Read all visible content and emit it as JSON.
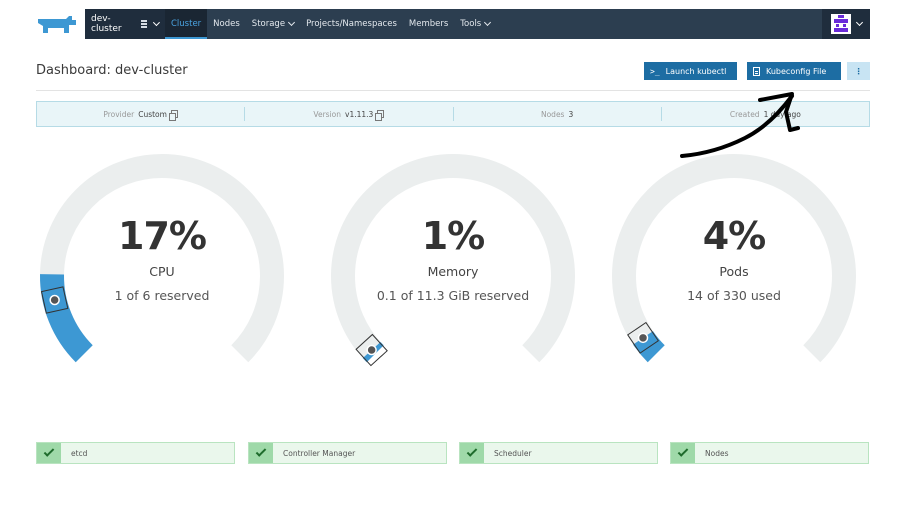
{
  "nav": {
    "cluster_name": "dev-cluster",
    "items": [
      {
        "label": "Cluster",
        "active": true
      },
      {
        "label": "Nodes"
      },
      {
        "label": "Storage",
        "dropdown": true
      },
      {
        "label": "Projects/Namespaces"
      },
      {
        "label": "Members"
      },
      {
        "label": "Tools",
        "dropdown": true
      }
    ]
  },
  "header": {
    "title": "Dashboard: dev-cluster",
    "launch_kubectl_label": "Launch kubectl",
    "kubeconfig_label": "Kubeconfig File",
    "more_label": "⋮"
  },
  "info": {
    "provider_label": "Provider",
    "provider_value": "Custom",
    "version_label": "Version",
    "version_value": "v1.11.3",
    "nodes_label": "Nodes",
    "nodes_value": "3",
    "created_label": "Created",
    "created_value": "1 day ago"
  },
  "gauges": [
    {
      "percent_text": "17%",
      "percent": 0.17,
      "reserved_fraction": 0.12,
      "label": "CPU",
      "sub": "1 of 6 reserved"
    },
    {
      "percent_text": "1%",
      "percent": 0.01,
      "reserved_fraction": 0.01,
      "label": "Memory",
      "sub": "0.1 of 11.3 GiB reserved"
    },
    {
      "percent_text": "4%",
      "percent": 0.04,
      "reserved_fraction": 0.04,
      "label": "Pods",
      "sub": "14 of 330 used"
    }
  ],
  "components": [
    {
      "label": "etcd",
      "status": "healthy"
    },
    {
      "label": "Controller Manager",
      "status": "healthy"
    },
    {
      "label": "Scheduler",
      "status": "healthy"
    },
    {
      "label": "Nodes",
      "status": "healthy"
    }
  ],
  "colors": {
    "nav_bg": "#2c3e50",
    "accent": "#3d98d3",
    "gauge_track": "#ebeeee",
    "gauge_fill": "#3d98d3",
    "healthy": "#9fd9a9"
  }
}
